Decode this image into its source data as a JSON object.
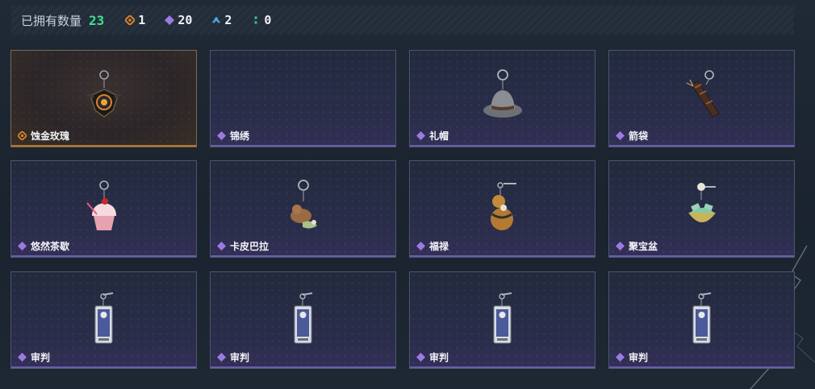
{
  "summary": {
    "label": "已拥有数量",
    "total": "23",
    "stats": [
      {
        "icon": "orange-rarity-icon",
        "value": "1",
        "color": "#d9822b"
      },
      {
        "icon": "purple-rarity-icon",
        "value": "20",
        "color": "#9b7be0"
      },
      {
        "icon": "blue-rarity-icon",
        "value": "2",
        "color": "#4aa6e0"
      },
      {
        "icon": "green-rarity-icon",
        "value": "0",
        "color": "#38c98a"
      }
    ]
  },
  "items": [
    {
      "name": "蚀金玫瑰",
      "rarity": "orange",
      "icon": "golden-rose-charm-icon"
    },
    {
      "name": "锦绣",
      "rarity": "purple",
      "icon": "empty-charm-icon"
    },
    {
      "name": "礼帽",
      "rarity": "purple",
      "icon": "top-hat-charm-icon"
    },
    {
      "name": "箭袋",
      "rarity": "purple",
      "icon": "quiver-charm-icon"
    },
    {
      "name": "悠然茶歇",
      "rarity": "purple",
      "icon": "cupcake-charm-icon"
    },
    {
      "name": "卡皮巴拉",
      "rarity": "purple",
      "icon": "capybara-charm-icon"
    },
    {
      "name": "福禄",
      "rarity": "purple",
      "icon": "gourd-charm-icon"
    },
    {
      "name": "聚宝盆",
      "rarity": "purple",
      "icon": "treasure-bowl-charm-icon"
    },
    {
      "name": "审判",
      "rarity": "purple",
      "icon": "judgment-card-charm-icon"
    },
    {
      "name": "审判",
      "rarity": "purple",
      "icon": "judgment-card-charm-icon"
    },
    {
      "name": "审判",
      "rarity": "purple",
      "icon": "judgment-card-charm-icon"
    },
    {
      "name": "审判",
      "rarity": "purple",
      "icon": "judgment-card-charm-icon"
    }
  ]
}
